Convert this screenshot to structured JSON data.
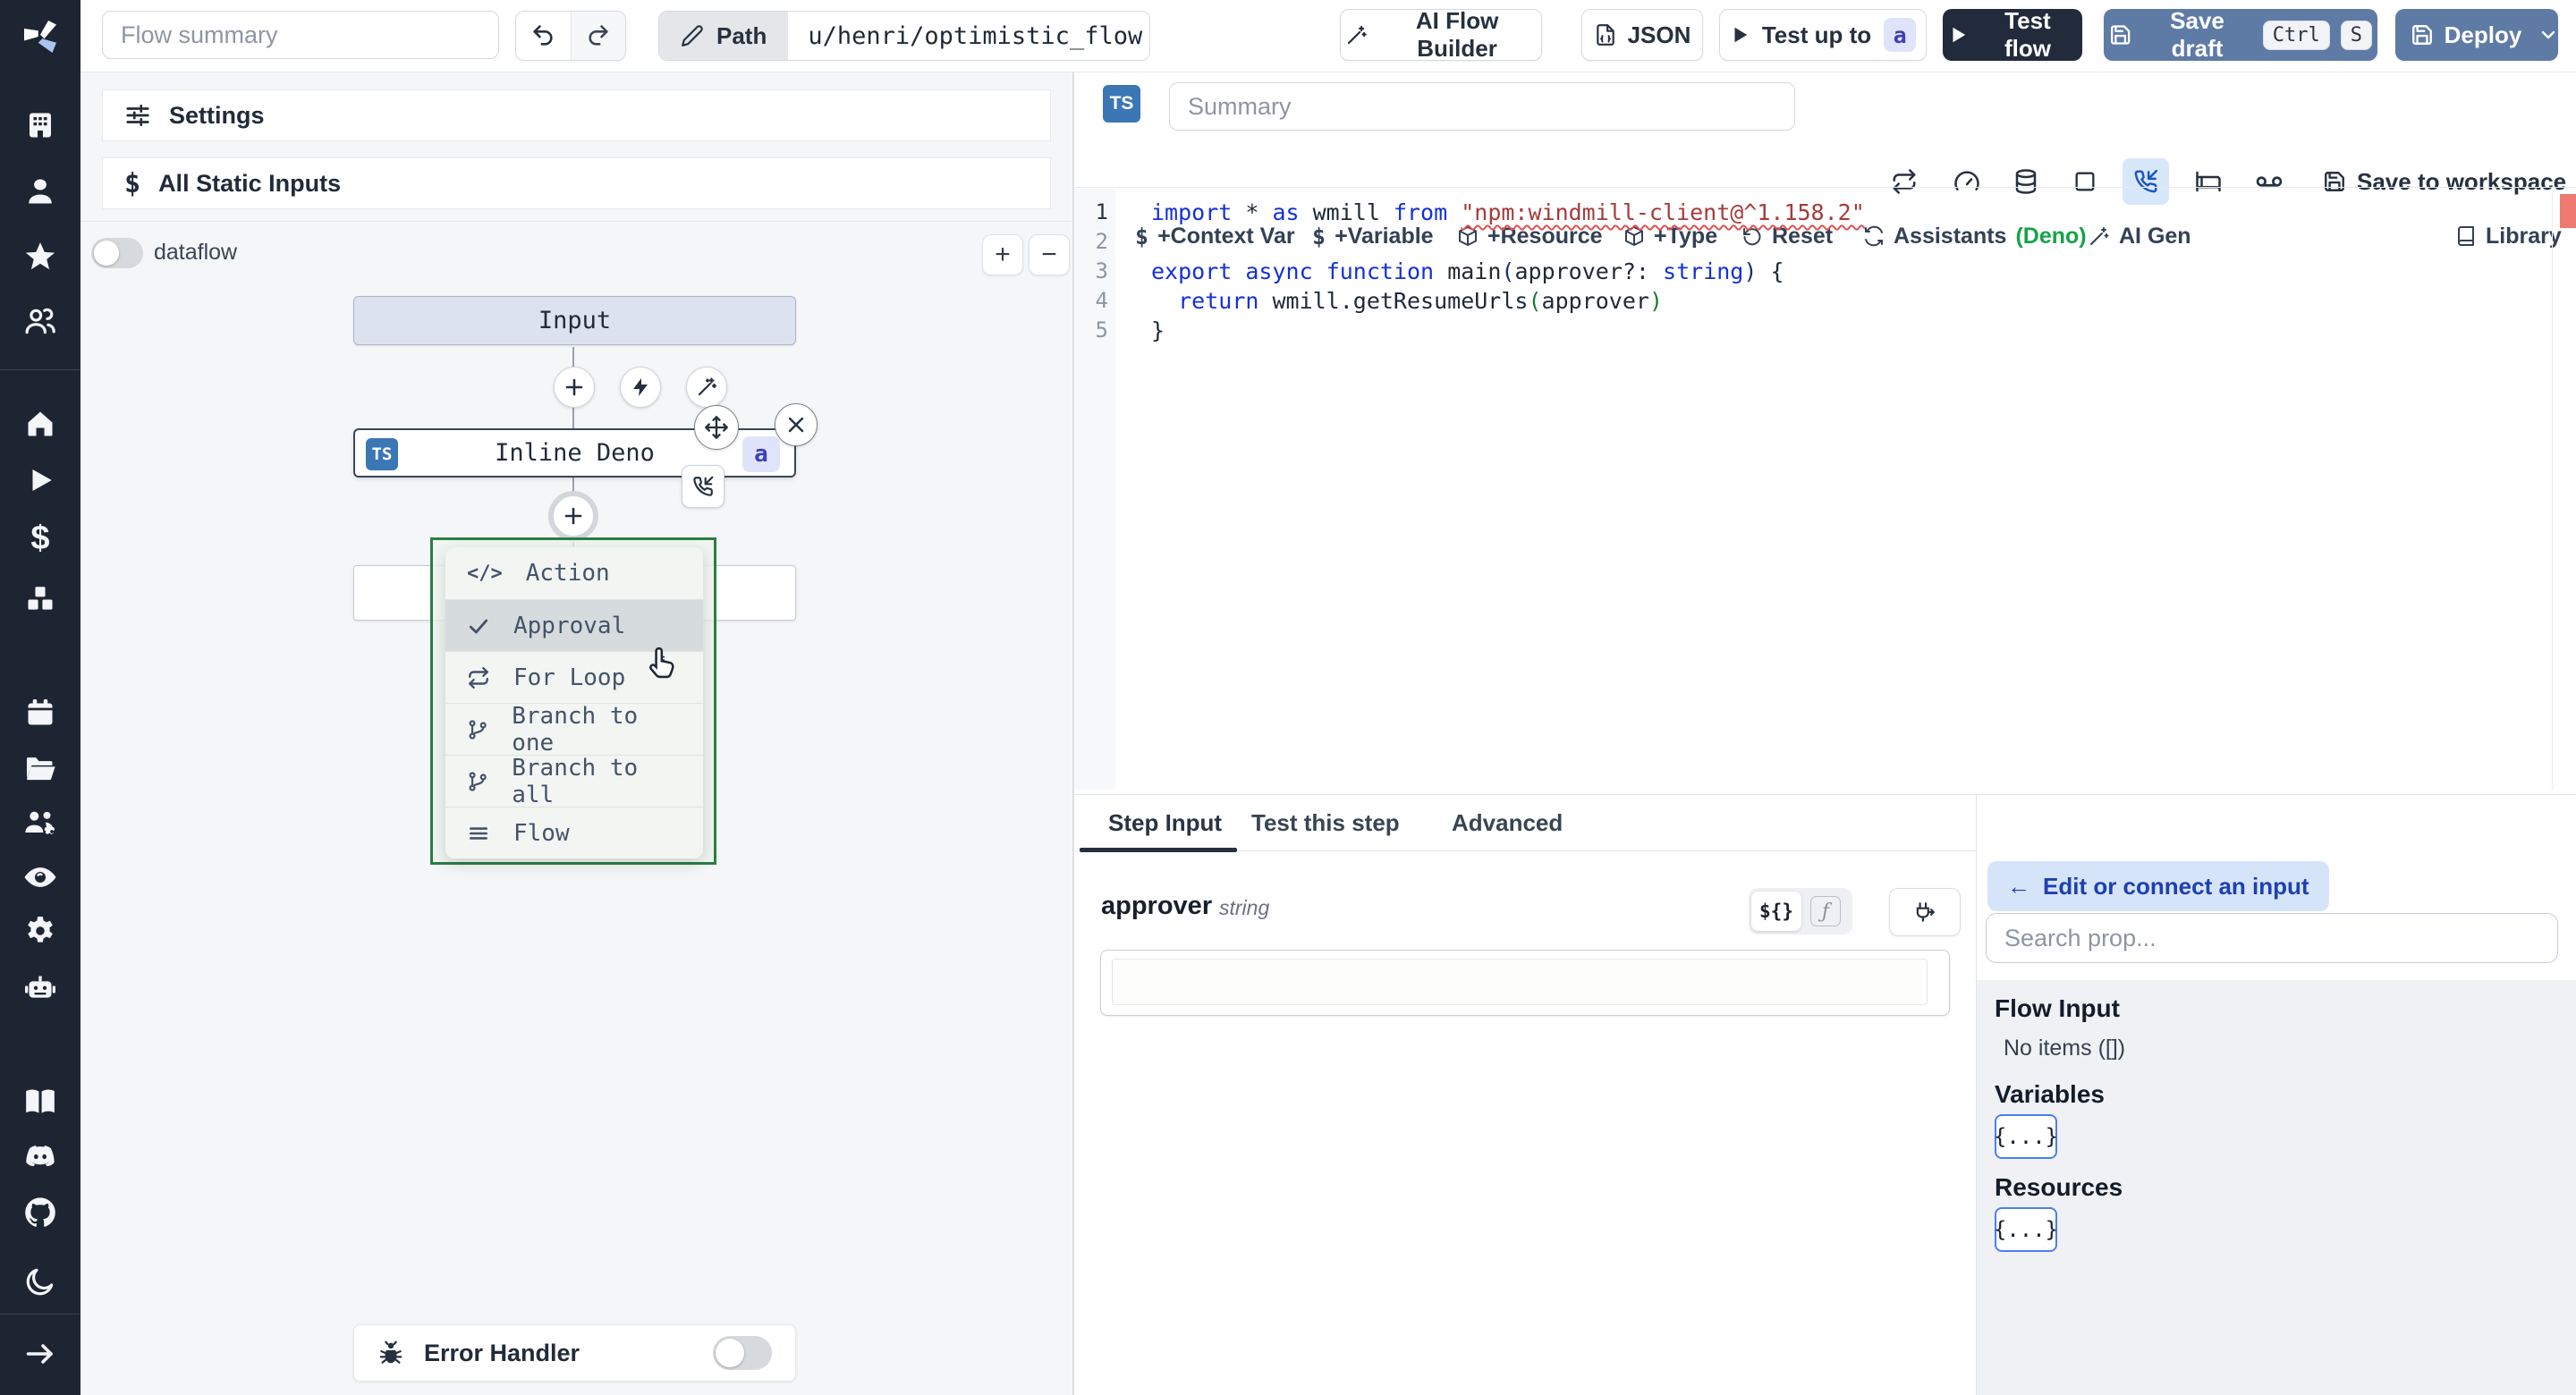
{
  "topbar": {
    "summary_placeholder": "Flow summary",
    "path_label": "Path",
    "path_value": "u/henri/optimistic_flow",
    "ai_flow_builder": "AI Flow Builder",
    "json": "JSON",
    "test_up_to": "Test up to",
    "test_up_to_badge": "a",
    "test_flow": "Test flow",
    "save_draft": "Save draft",
    "kbd_ctrl": "Ctrl",
    "kbd_s": "S",
    "deploy": "Deploy"
  },
  "sidebar": {
    "icons": [
      "windmill-logo",
      "buildings",
      "user",
      "star",
      "user-group",
      "home",
      "play",
      "dollar",
      "boxes",
      "calendar",
      "folder-open",
      "users-gear",
      "eye",
      "gear",
      "robot",
      "book-open",
      "discord",
      "github",
      "moon",
      "expand-arrow"
    ]
  },
  "flow_panel": {
    "settings": "Settings",
    "all_static_inputs": "All Static Inputs",
    "dataflow": "dataflow",
    "zoom_in": "+",
    "zoom_out": "−",
    "input_node": "Input",
    "step_node": {
      "badge": "TS",
      "label": "Inline Deno",
      "suffix": "a"
    },
    "insert_menu": {
      "items": [
        {
          "icon": "code-icon",
          "label": "Action"
        },
        {
          "icon": "check-icon",
          "label": "Approval"
        },
        {
          "icon": "repeat-icon",
          "label": "For Loop"
        },
        {
          "icon": "branch-icon",
          "label": "Branch to one"
        },
        {
          "icon": "branch-icon",
          "label": "Branch to all"
        },
        {
          "icon": "menu-icon",
          "label": "Flow"
        }
      ]
    },
    "error_handler": "Error Handler"
  },
  "editor": {
    "badge": "TS",
    "summary_placeholder": "Summary",
    "save_to_workspace": "Save to workspace",
    "status_color": "#48d06a",
    "toolbar": {
      "context_var": "+Context Var",
      "variable": "+Variable",
      "resource": "+Resource",
      "type": "+Type",
      "reset": "Reset",
      "assistants": "Assistants",
      "assistants_suffix": "(Deno)",
      "assistants_suffix_color": "#15a34a",
      "ai_gen": "AI Gen",
      "library": "Library"
    },
    "code": {
      "line_numbers": [
        "1",
        "2",
        "3",
        "4",
        "5"
      ],
      "lines": [
        [
          {
            "t": "import",
            "c": "kw"
          },
          {
            "t": " * ",
            "c": "pl"
          },
          {
            "t": "as",
            "c": "kw"
          },
          {
            "t": " wmill ",
            "c": "pl"
          },
          {
            "t": "from",
            "c": "kw"
          },
          {
            "t": " ",
            "c": "pl"
          },
          {
            "t": "\"npm:windmill-client@^1.158.2\"",
            "c": "se"
          }
        ],
        [],
        [
          {
            "t": "export",
            "c": "kw"
          },
          {
            "t": " ",
            "c": "pl"
          },
          {
            "t": "async",
            "c": "kw"
          },
          {
            "t": " ",
            "c": "pl"
          },
          {
            "t": "function",
            "c": "kw"
          },
          {
            "t": " ",
            "c": "pl"
          },
          {
            "t": "main",
            "c": "fn"
          },
          {
            "t": "(",
            "c": "pa"
          },
          {
            "t": "approver?: ",
            "c": "pl"
          },
          {
            "t": "string",
            "c": "kw"
          },
          {
            "t": ")",
            "c": "pa"
          },
          {
            "t": " {",
            "c": "pl"
          }
        ],
        [
          {
            "t": "  ",
            "c": "pl"
          },
          {
            "t": "return",
            "c": "kw"
          },
          {
            "t": " wmill.getResumeUrls",
            "c": "pl"
          },
          {
            "t": "(",
            "c": "pb"
          },
          {
            "t": "approver",
            "c": "pl"
          },
          {
            "t": ")",
            "c": "pb"
          }
        ],
        [
          {
            "t": "}",
            "c": "pl"
          }
        ]
      ]
    }
  },
  "step_panel": {
    "tabs": [
      "Step Input",
      "Test this step",
      "Advanced"
    ],
    "field": {
      "name": "approver",
      "type": "string",
      "value": ""
    },
    "toggle": {
      "expr": "${}",
      "fn": "ƒ"
    }
  },
  "connect_panel": {
    "back_arrow": "←",
    "back": "Edit or connect an input",
    "search_placeholder": "Search prop...",
    "flow_input": {
      "title": "Flow Input",
      "empty": "No items ([])"
    },
    "variables": {
      "title": "Variables",
      "expander": "{...}"
    },
    "resources": {
      "title": "Resources",
      "expander": "{...}"
    }
  }
}
